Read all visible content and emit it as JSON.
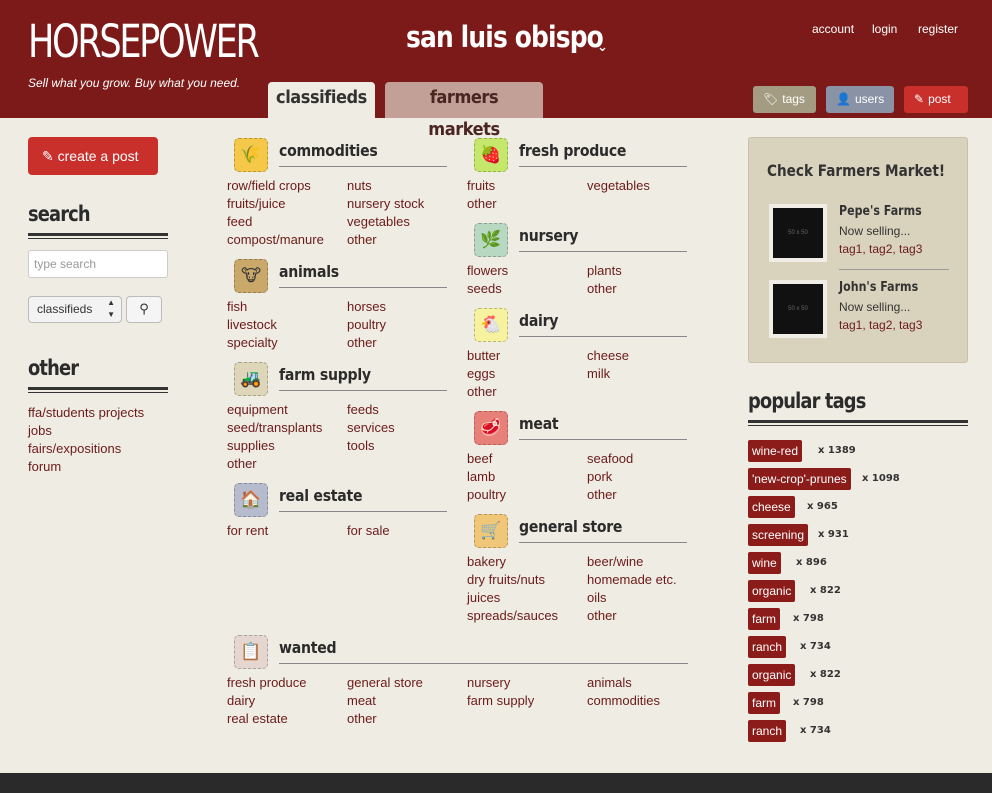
{
  "header": {
    "logo": "HORSEPOWER",
    "tagline": "Sell what you grow. Buy what you need.",
    "city": "san luis obispo",
    "top_links": [
      "account",
      "login",
      "register"
    ],
    "tabs": [
      {
        "label": "classifieds",
        "active": true
      },
      {
        "label": "farmers markets",
        "active": false
      }
    ],
    "buttons": {
      "tags": "tags",
      "users": "users",
      "post": "post"
    }
  },
  "left": {
    "create_post": "create a post",
    "search_title": "search",
    "search_placeholder": "type search",
    "select_value": "classifieds",
    "other_title": "other",
    "other_links": [
      "ffa/students projects",
      "jobs",
      "fairs/expositions",
      "forum"
    ]
  },
  "categories": {
    "commodities": {
      "title": "commodities",
      "links": [
        "row/field crops",
        "nuts",
        "fruits/juice",
        "nursery stock",
        "feed",
        "vegetables",
        "compost/manure",
        "other"
      ]
    },
    "animals": {
      "title": "animals",
      "links": [
        "fish",
        "horses",
        "livestock",
        "poultry",
        "specialty",
        "other"
      ]
    },
    "farm_supply": {
      "title": "farm supply",
      "links": [
        "equipment",
        "feeds",
        "seed/transplants",
        "services",
        "supplies",
        "tools",
        "other"
      ]
    },
    "real_estate": {
      "title": "real estate",
      "links": [
        "for rent",
        "for sale"
      ]
    },
    "fresh_produce": {
      "title": "fresh produce",
      "links": [
        "fruits",
        "vegetables",
        "other"
      ]
    },
    "nursery": {
      "title": "nursery",
      "links": [
        "flowers",
        "plants",
        "seeds",
        "other"
      ]
    },
    "dairy": {
      "title": "dairy",
      "links": [
        "butter",
        "cheese",
        "eggs",
        "milk",
        "other"
      ]
    },
    "meat": {
      "title": "meat",
      "links": [
        "beef",
        "seafood",
        "lamb",
        "pork",
        "poultry",
        "other"
      ]
    },
    "general_store": {
      "title": "general store",
      "links": [
        "bakery",
        "beer/wine",
        "dry fruits/nuts",
        "homemade etc.",
        "juices",
        "oils",
        "spreads/sauces",
        "other"
      ]
    },
    "wanted": {
      "title": "wanted",
      "links": [
        "fresh produce",
        "general store",
        "nursery",
        "animals",
        "dairy",
        "meat",
        "farm supply",
        "commodities",
        "real estate",
        "other"
      ]
    }
  },
  "farmers_market": {
    "title": "Check Farmers Market!",
    "items": [
      {
        "name": "Pepe's Farms",
        "status": "Now selling...",
        "tags": "tag1, tag2, tag3",
        "thumb": "50 x 50"
      },
      {
        "name": "John's Farms",
        "status": "Now selling...",
        "tags": "tag1, tag2, tag3",
        "thumb": "50 x 50"
      }
    ]
  },
  "popular_tags": {
    "title": "popular tags",
    "tags": [
      {
        "label": "wine-red",
        "count": "x 1389"
      },
      {
        "label": "'new-crop'-prunes",
        "count": "x 1098"
      },
      {
        "label": "cheese",
        "count": "x 965"
      },
      {
        "label": "screening",
        "count": "x 931"
      },
      {
        "label": "wine",
        "count": "x 896"
      },
      {
        "label": "organic",
        "count": "x 822"
      },
      {
        "label": "farm",
        "count": "x 798"
      },
      {
        "label": "ranch",
        "count": "x 734"
      },
      {
        "label": "organic",
        "count": "x 822"
      },
      {
        "label": "farm",
        "count": "x 798"
      },
      {
        "label": "ranch",
        "count": "x 734"
      }
    ]
  }
}
